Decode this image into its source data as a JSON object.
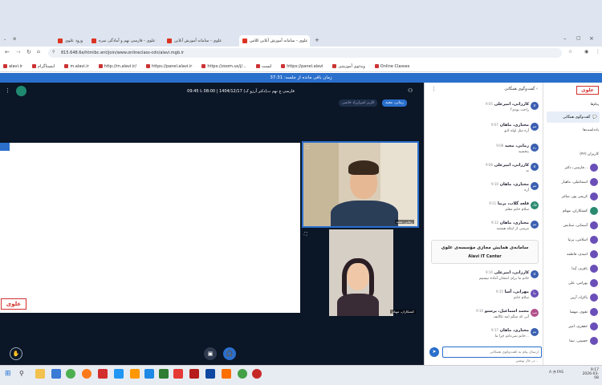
{
  "browser": {
    "tabs": [
      {
        "label": "ورود علوی"
      },
      {
        "label": "علوی - فارسی نهم و آمادگی نمره"
      },
      {
        "label": "علوی - سامانه آموزش آنلاین"
      },
      {
        "label": "علوی - سامانه آموزش آنلاین کلاس"
      }
    ],
    "new_tab": "+",
    "url": "815.648.6e/htmlbc.ent/join/www.onlineclass-cdn/alavi.mgb.ir",
    "bookmarks": [
      "alavi.ir",
      "اینستاگرام",
      "m.alavi.ir",
      "http://m.alavi.ir/",
      "https://panel.alavi.ir",
      "https://zoom.us/j/...",
      "لیست",
      "https://panel.alavi",
      "ویدئوی آموزشی",
      "Online Classes"
    ]
  },
  "session": {
    "timer_text": "زمان باقی مانده از جلسه: 37:31",
    "class_info": "فارسی ج نهم ت(دکتر آرزو ک) 1404/12/17 | 08:00 تا 09:45",
    "tag_active": "رمانی، مجید",
    "tag_teacher": "کاربر اسرارزاد خانمی"
  },
  "videos": {
    "student_name": "رمانی، مجید",
    "teacher_name": "کشتکاران، مهنام"
  },
  "chat": {
    "header": "گفت‌وگوی همگانی",
    "messages": [
      {
        "name": "کارزانی، امیرعلی",
        "time": "9:05",
        "text": "راحت بودی؟"
      },
      {
        "name": "مختاری، ماهان",
        "time": "9:07",
        "text": "آره مثل اوله لایو"
      },
      {
        "name": "رمانی، مجید",
        "time": "9:08",
        "text": "ببخشید"
      },
      {
        "name": "کارزانی، امیرعلی",
        "time": "9:08",
        "text": "نه"
      },
      {
        "name": "مختاری، ماهان",
        "time": "9:10",
        "text": "آره"
      },
      {
        "name": "قلعه گلاب، پرنیا",
        "time": "9:11",
        "text": "سلام خانم معلم"
      },
      {
        "name": "مختاری، ماهان",
        "time": "9:12",
        "text": "مرسی از اینکه هستید"
      }
    ],
    "banner_fa": "سامانه‌ی همایش مجازی مؤسسه‌ی علوی",
    "banner_en": "Alavi IT Center",
    "messages2": [
      {
        "name": "کارزانی، امیرعلی",
        "time": "9:14",
        "text": "خانم ما برای امتحان آماده نیستیم"
      },
      {
        "name": "مهرانی، آسا",
        "time": "9:15",
        "text": "سلام خانم"
      },
      {
        "name": "محمد اسماعیل، پرستو",
        "time": "9:16",
        "text": "آنی که میگم اینه تکالیف"
      },
      {
        "name": "مختاری، ماهان",
        "time": "9:17",
        "text": "خانم نمی‌دانم چرا ما..."
      }
    ],
    "input_placeholder": "ارسال پیام به گفت‌وگوی همگانی",
    "typing": "در حال نوشتن..."
  },
  "nav": {
    "brand": "علوی",
    "items": [
      "پیام‌ها",
      "گفت‌وگوی همگانی",
      "یادداشت‌ها",
      "کاربران (۴۲)"
    ],
    "users": [
      {
        "name": "فارسی، دکتر...",
        "sub": "(شما)"
      },
      {
        "name": "اسماعیلی، ماهیار",
        "sub": ""
      },
      {
        "name": "کریمی پور، ساغر",
        "sub": ""
      },
      {
        "name": "کشتکاران، مهنام",
        "sub": "برگزارکننده"
      },
      {
        "name": "آسمانی، ستایش",
        "sub": ""
      },
      {
        "name": "اسلامی، پرنیا",
        "sub": ""
      },
      {
        "name": "امیدی، فاطمه",
        "sub": ""
      },
      {
        "name": "باقری، آیدا",
        "sub": ""
      },
      {
        "name": "بهرامی، علی",
        "sub": ""
      },
      {
        "name": "پاکزاد، آرین",
        "sub": ""
      },
      {
        "name": "تقوی، مهسا",
        "sub": ""
      },
      {
        "name": "جعفری، امیر",
        "sub": ""
      },
      {
        "name": "حسینی، نیما",
        "sub": ""
      }
    ]
  },
  "taskbar": {
    "time": "9:17",
    "date": "2026-03-08",
    "lang": "FAS"
  },
  "colors": {
    "accent": "#2a6fcc",
    "stage": "#0b1627",
    "brand": "#d32f2f"
  }
}
